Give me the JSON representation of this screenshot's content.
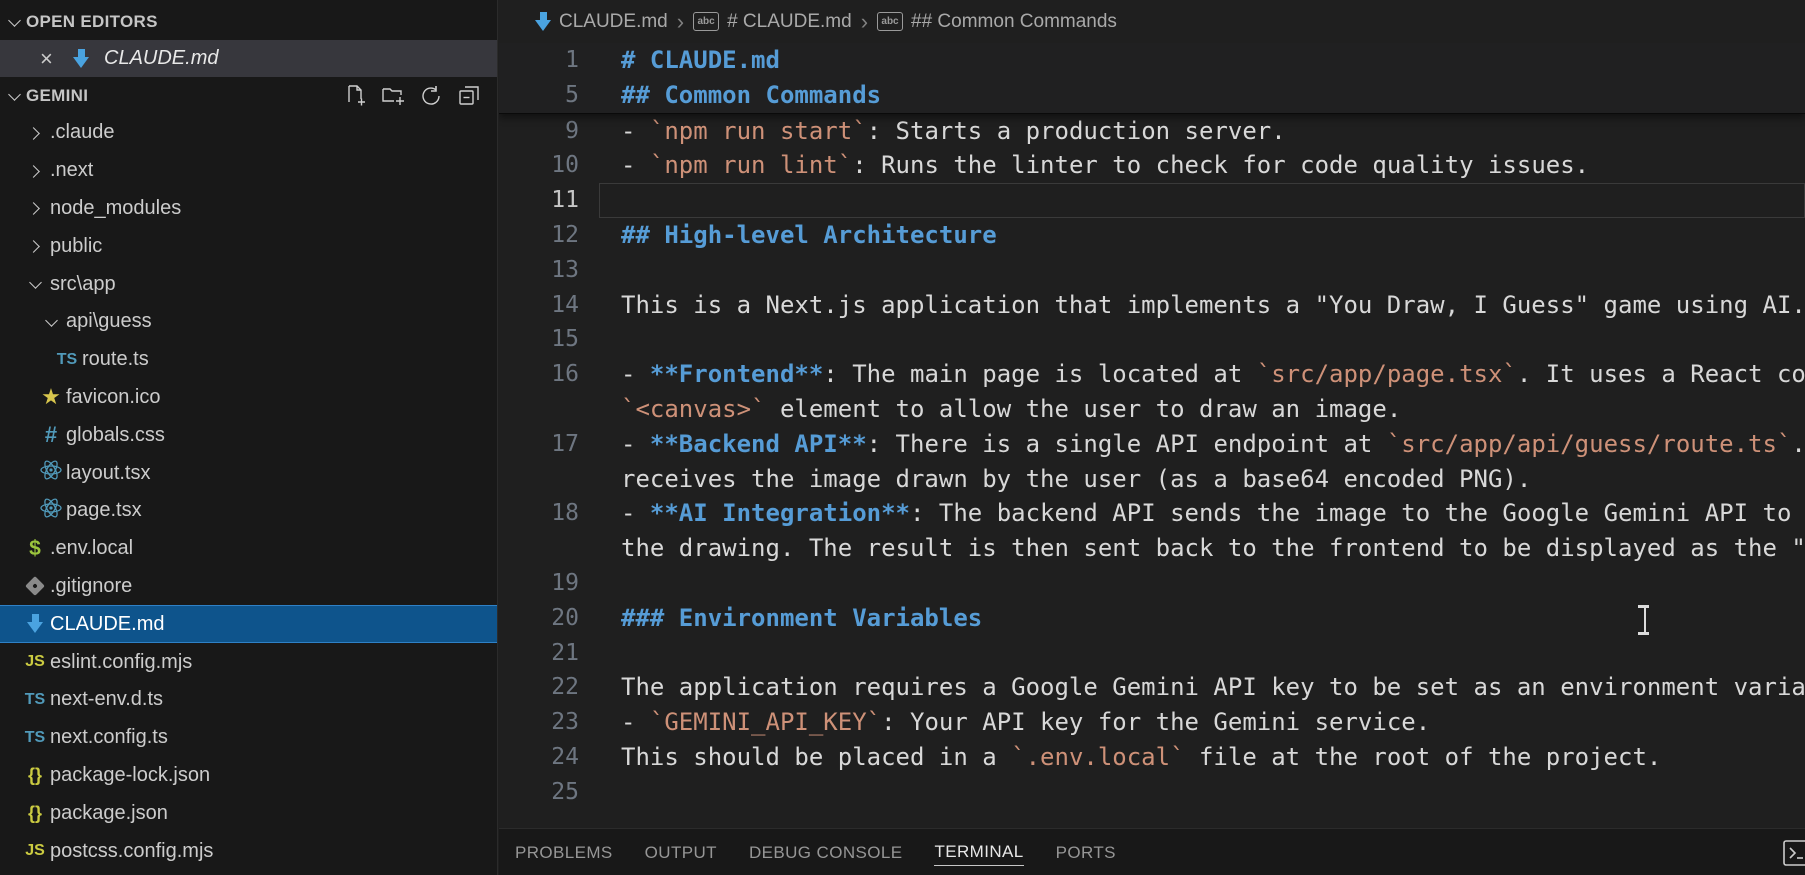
{
  "colors": {
    "sidebar_bg": "#181818",
    "editor_bg": "#1f1f1f",
    "selection_blue": "#0e548c",
    "selection_border": "#2f81c6",
    "open_editor_selected": "#37373d",
    "heading_blue": "#569cd6",
    "inline_code_orange": "#ce9178",
    "line_number": "#6e7681",
    "icon_blue": "#519aba",
    "icon_yellow": "#cbcb41"
  },
  "sidebar": {
    "open_editors": {
      "header": "OPEN EDITORS",
      "items": [
        {
          "name": "CLAUDE.md",
          "icon": "markdown",
          "close_label": "×"
        }
      ]
    },
    "explorer": {
      "header": "GEMINI",
      "actions": [
        {
          "name": "new-file"
        },
        {
          "name": "new-folder"
        },
        {
          "name": "refresh"
        },
        {
          "name": "collapse-all"
        }
      ],
      "tree": [
        {
          "label": ".claude",
          "kind": "folder",
          "depth": 1,
          "expanded": false
        },
        {
          "label": ".next",
          "kind": "folder",
          "depth": 1,
          "expanded": false
        },
        {
          "label": "node_modules",
          "kind": "folder",
          "depth": 1,
          "expanded": false
        },
        {
          "label": "public",
          "kind": "folder",
          "depth": 1,
          "expanded": false
        },
        {
          "label": "src\\app",
          "kind": "folder",
          "depth": 1,
          "expanded": true
        },
        {
          "label": "api\\guess",
          "kind": "folder",
          "depth": 2,
          "expanded": true
        },
        {
          "label": "route.ts",
          "kind": "file",
          "icon": "typescript",
          "depth": 3
        },
        {
          "label": "favicon.ico",
          "kind": "file",
          "icon": "star",
          "depth": 2
        },
        {
          "label": "globals.css",
          "kind": "file",
          "icon": "css-hash",
          "depth": 2
        },
        {
          "label": "layout.tsx",
          "kind": "file",
          "icon": "react",
          "depth": 2
        },
        {
          "label": "page.tsx",
          "kind": "file",
          "icon": "react",
          "depth": 2
        },
        {
          "label": ".env.local",
          "kind": "file",
          "icon": "env-dollar",
          "depth": 1
        },
        {
          "label": ".gitignore",
          "kind": "file",
          "icon": "git",
          "depth": 1
        },
        {
          "label": "CLAUDE.md",
          "kind": "file",
          "icon": "markdown",
          "depth": 1,
          "selected": true
        },
        {
          "label": "eslint.config.mjs",
          "kind": "file",
          "icon": "javascript",
          "depth": 1
        },
        {
          "label": "next-env.d.ts",
          "kind": "file",
          "icon": "typescript",
          "depth": 1
        },
        {
          "label": "next.config.ts",
          "kind": "file",
          "icon": "typescript",
          "depth": 1
        },
        {
          "label": "package-lock.json",
          "kind": "file",
          "icon": "json-braces",
          "depth": 1
        },
        {
          "label": "package.json",
          "kind": "file",
          "icon": "json-braces",
          "depth": 1
        },
        {
          "label": "postcss.config.mjs",
          "kind": "file",
          "icon": "javascript",
          "depth": 1
        }
      ]
    }
  },
  "breadcrumb": {
    "separator": "›",
    "items": [
      {
        "icon": "markdown",
        "label": "CLAUDE.md"
      },
      {
        "icon": "symbol-abc",
        "label": "# CLAUDE.md"
      },
      {
        "icon": "symbol-abc",
        "label": "## Common Commands"
      }
    ]
  },
  "editor": {
    "sticky_lines": [
      {
        "num": "1",
        "segs": [
          {
            "t": "# CLAUDE.md",
            "s": "heading"
          }
        ]
      },
      {
        "num": "5",
        "segs": [
          {
            "t": "## Common Commands",
            "s": "heading"
          }
        ]
      }
    ],
    "lines": [
      {
        "num": "9",
        "segs": [
          {
            "t": "- ",
            "s": "text"
          },
          {
            "t": "`npm run start`",
            "s": "code"
          },
          {
            "t": ": Starts a production server.",
            "s": "text"
          }
        ]
      },
      {
        "num": "10",
        "segs": [
          {
            "t": "- ",
            "s": "text"
          },
          {
            "t": "`npm run lint`",
            "s": "code"
          },
          {
            "t": ": Runs the linter to check for code quality issues.",
            "s": "text"
          }
        ]
      },
      {
        "num": "11",
        "current": true,
        "segs": []
      },
      {
        "num": "12",
        "segs": [
          {
            "t": "## High-level Architecture",
            "s": "heading"
          }
        ]
      },
      {
        "num": "13",
        "segs": []
      },
      {
        "num": "14",
        "segs": [
          {
            "t": "This is a Next.js application that implements a \"You Draw, I Guess\" game using AI.",
            "s": "text"
          }
        ]
      },
      {
        "num": "15",
        "segs": []
      },
      {
        "num": "16",
        "segs": [
          {
            "t": "- ",
            "s": "text"
          },
          {
            "t": "**Frontend**",
            "s": "bold"
          },
          {
            "t": ": The main page is located at ",
            "s": "text"
          },
          {
            "t": "`src/app/page.tsx`",
            "s": "code"
          },
          {
            "t": ". It uses a React com",
            "s": "text"
          }
        ]
      },
      {
        "num": "",
        "segs": [
          {
            "t": "`<canvas>`",
            "s": "code"
          },
          {
            "t": " element to allow the user to draw an image.",
            "s": "text"
          }
        ]
      },
      {
        "num": "17",
        "segs": [
          {
            "t": "- ",
            "s": "text"
          },
          {
            "t": "**Backend API**",
            "s": "bold"
          },
          {
            "t": ": There is a single API endpoint at ",
            "s": "text"
          },
          {
            "t": "`src/app/api/guess/route.ts`",
            "s": "code"
          },
          {
            "t": ". ",
            "s": "text"
          }
        ]
      },
      {
        "num": "",
        "segs": [
          {
            "t": "receives the image drawn by the user (as a base64 encoded PNG).",
            "s": "text"
          }
        ]
      },
      {
        "num": "18",
        "segs": [
          {
            "t": "- ",
            "s": "text"
          },
          {
            "t": "**AI Integration**",
            "s": "bold"
          },
          {
            "t": ": The backend API sends the image to the Google Gemini API to g",
            "s": "text"
          }
        ]
      },
      {
        "num": "",
        "segs": [
          {
            "t": "the drawing. The result is then sent back to the frontend to be displayed as the \"g",
            "s": "text"
          }
        ]
      },
      {
        "num": "19",
        "segs": []
      },
      {
        "num": "20",
        "segs": [
          {
            "t": "### Environment Variables",
            "s": "heading"
          }
        ]
      },
      {
        "num": "21",
        "segs": []
      },
      {
        "num": "22",
        "segs": [
          {
            "t": "The application requires a Google Gemini API key to be set as an environment variab",
            "s": "text"
          }
        ]
      },
      {
        "num": "23",
        "segs": [
          {
            "t": "- ",
            "s": "text"
          },
          {
            "t": "`GEMINI_API_KEY`",
            "s": "code"
          },
          {
            "t": ": Your API key for the Gemini service.",
            "s": "text"
          }
        ]
      },
      {
        "num": "24",
        "segs": [
          {
            "t": "This should be placed in a ",
            "s": "text"
          },
          {
            "t": "`.env.local`",
            "s": "code"
          },
          {
            "t": " file at the root of the project.",
            "s": "text"
          }
        ]
      },
      {
        "num": "25",
        "segs": []
      }
    ]
  },
  "panel": {
    "tabs": [
      {
        "label": "PROBLEMS",
        "active": false
      },
      {
        "label": "OUTPUT",
        "active": false
      },
      {
        "label": "DEBUG CONSOLE",
        "active": false
      },
      {
        "label": "TERMINAL",
        "active": true
      },
      {
        "label": "PORTS",
        "active": false
      }
    ]
  }
}
